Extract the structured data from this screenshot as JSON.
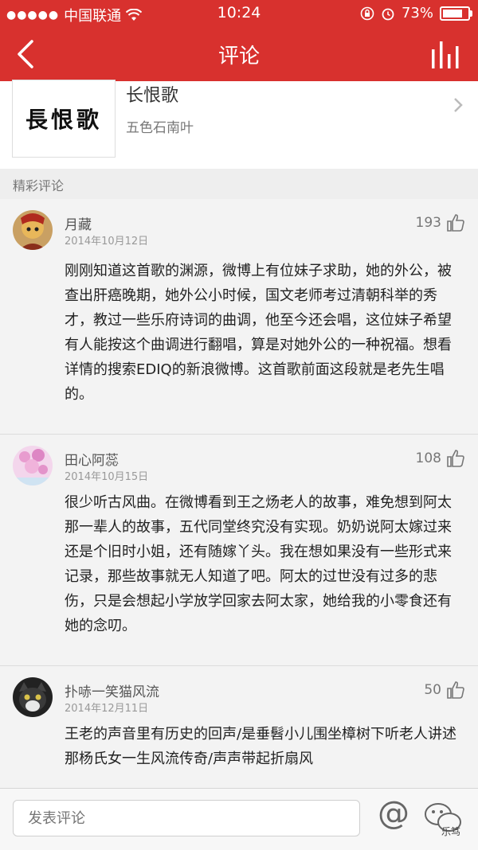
{
  "status": {
    "carrier": "中国联通",
    "time": "10:24",
    "battery": "73%"
  },
  "nav": {
    "title": "评论"
  },
  "song": {
    "cover_text": "長恨歌",
    "title": "长恨歌",
    "artist": "五色石南叶"
  },
  "section": {
    "label": "精彩评论"
  },
  "comments": [
    {
      "user": "月藏",
      "date": "2014年10月12日",
      "likes": "193",
      "text": " 刚刚知道这首歌的渊源，微博上有位妹子求助，她的外公，被查出肝癌晚期，她外公小时候，国文老师考过清朝科举的秀才，教过一些乐府诗词的曲调，他至今还会唱，这位妹子希望有人能按这个曲调进行翻唱，算是对她外公的一种祝福。想看详情的搜索EDIQ的新浪微博。这首歌前面这段就是老先生唱的。"
    },
    {
      "user": "田心阿蕊",
      "date": "2014年10月15日",
      "likes": "108",
      "text": "很少听古风曲。在微博看到王之炀老人的故事，难免想到阿太那一辈人的故事，五代同堂终究没有实现。奶奶说阿太嫁过来还是个旧时小姐，还有随嫁丫头。我在想如果没有一些形式来记录，那些故事就无人知道了吧。阿太的过世没有过多的悲伤，只是会想起小学放学回家去阿太家，她给我的小零食还有她的念叨。"
    },
    {
      "user": "扑哧一笑猫风流",
      "date": "2014年12月11日",
      "likes": "50",
      "text": "王老的声音里有历史的回声/是垂髫小儿围坐樟树下听老人讲述那杨氏女一生风流传奇/声声带起折扇风"
    }
  ],
  "input": {
    "placeholder": "发表评论",
    "at_label": "@"
  },
  "watermark": "乐笃",
  "colors": {
    "header_red": "#d8312e"
  }
}
